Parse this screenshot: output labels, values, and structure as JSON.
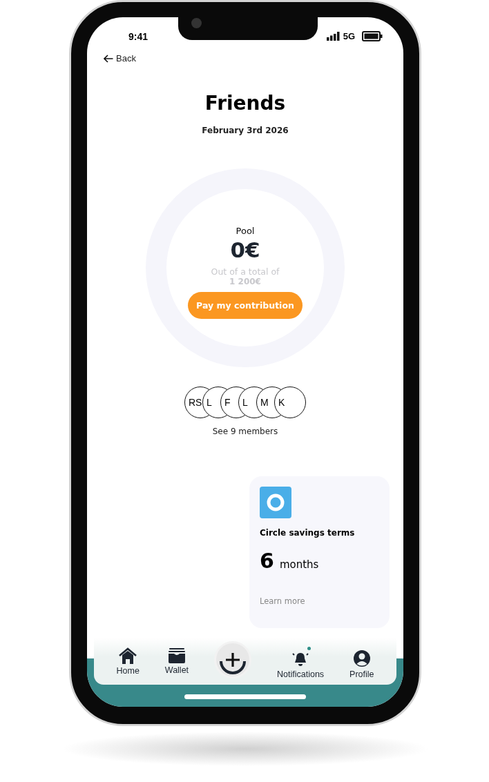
{
  "status_bar": {
    "time": "9:41",
    "network": "5G"
  },
  "back": {
    "label": "Back"
  },
  "title": "Friends",
  "date": "February 3rd 2026",
  "pool": {
    "label": "Pool",
    "amount": "0€",
    "total_label": "Out of a total of",
    "total": "1 200€",
    "button": "Pay my contribution"
  },
  "members": {
    "avatars": [
      "RS",
      "L",
      "F",
      "L",
      "M",
      "K"
    ],
    "link": "See 9 members"
  },
  "card": {
    "title": "Circle savings terms",
    "value": "6",
    "unit": "months",
    "link": "Learn more"
  },
  "nav": [
    {
      "kind": "home",
      "label": "Home",
      "badge": false
    },
    {
      "kind": "wallet",
      "label": "Wallet",
      "badge": false
    },
    {
      "kind": "add"
    },
    {
      "kind": "bell",
      "label": "Notifications",
      "badge": true
    },
    {
      "kind": "profile",
      "label": "Profile",
      "badge": false
    }
  ]
}
